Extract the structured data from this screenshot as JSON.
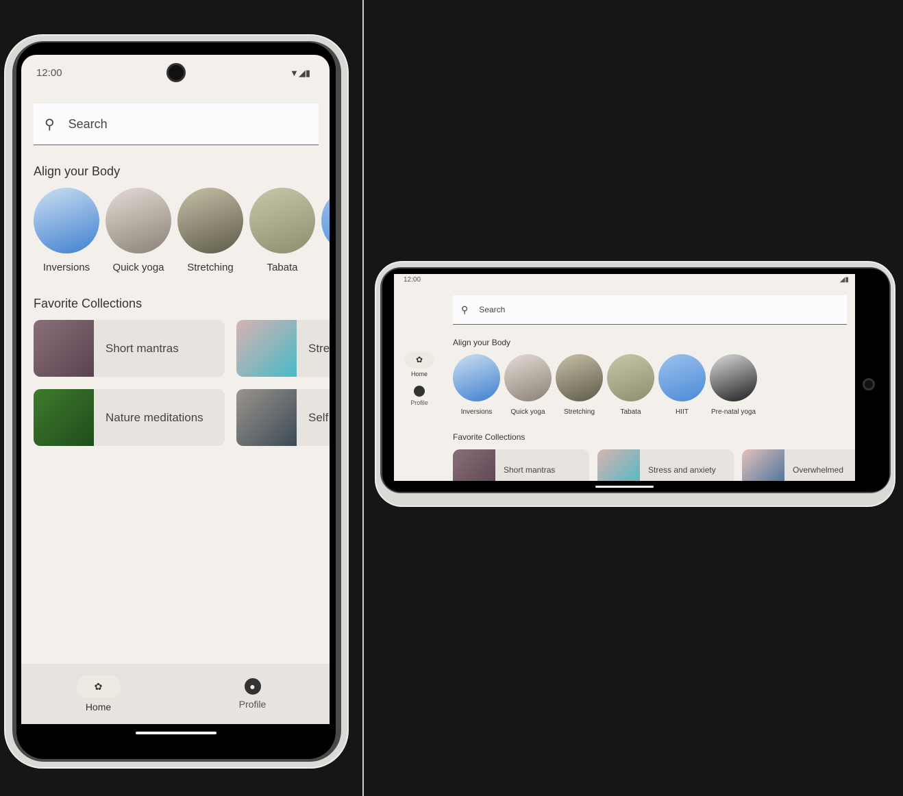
{
  "status": {
    "time": "12:00"
  },
  "search": {
    "placeholder": "Search"
  },
  "align": {
    "title": "Align your Body",
    "items": [
      {
        "label": "Inversions",
        "colors": [
          "#3f7fcf",
          "#cbe0f2"
        ]
      },
      {
        "label": "Quick yoga",
        "colors": [
          "#8a8078",
          "#e5ddd5"
        ]
      },
      {
        "label": "Stretching",
        "colors": [
          "#5c5a48",
          "#c8c1a8"
        ]
      },
      {
        "label": "Tabata",
        "colors": [
          "#8d8e6e",
          "#c9c7ab"
        ]
      },
      {
        "label": "HIIT",
        "colors": [
          "#4a8ad8",
          "#9dc2ec"
        ]
      },
      {
        "label": "Pre-natal yoga",
        "colors": [
          "#1e1e1e",
          "#dcdcdc"
        ]
      }
    ]
  },
  "favorites": {
    "title": "Favorite Collections",
    "items": [
      {
        "label": "Short mantras",
        "colors": [
          "#5a4450",
          "#8a6f78"
        ]
      },
      {
        "label": "Stress and anxiety",
        "colors": [
          "#47b9c8",
          "#d9b3b0"
        ]
      },
      {
        "label": "Overwhelmed",
        "colors": [
          "#3d6e98",
          "#e6c0bd"
        ]
      },
      {
        "label": "Nature meditations",
        "colors": [
          "#1f4d1b",
          "#3f7a2c"
        ]
      },
      {
        "label": "Self",
        "colors": [
          "#3c4a55",
          "#9a958e"
        ]
      }
    ]
  },
  "nav": {
    "home": "Home",
    "profile": "Profile"
  }
}
